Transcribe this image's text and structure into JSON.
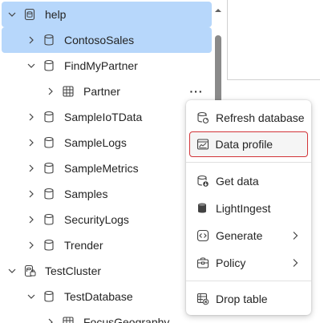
{
  "tree": {
    "rows": [
      {
        "label": "help",
        "kind": "cluster",
        "expanded": true,
        "selected": true
      },
      {
        "label": "ContosoSales",
        "kind": "database",
        "expanded": false,
        "selected": true
      },
      {
        "label": "FindMyPartner",
        "kind": "database",
        "expanded": true,
        "selected": false
      },
      {
        "label": "Partner",
        "kind": "table",
        "expanded": false,
        "selected": false
      },
      {
        "label": "SampleIoTData",
        "kind": "database",
        "expanded": false,
        "selected": false
      },
      {
        "label": "SampleLogs",
        "kind": "database",
        "expanded": false,
        "selected": false
      },
      {
        "label": "SampleMetrics",
        "kind": "database",
        "expanded": false,
        "selected": false
      },
      {
        "label": "Samples",
        "kind": "database",
        "expanded": false,
        "selected": false
      },
      {
        "label": "SecurityLogs",
        "kind": "database",
        "expanded": false,
        "selected": false
      },
      {
        "label": "Trender",
        "kind": "database",
        "expanded": false,
        "selected": false
      },
      {
        "label": "TestCluster",
        "kind": "cluster",
        "expanded": true,
        "selected": false
      },
      {
        "label": "TestDatabase",
        "kind": "database",
        "expanded": true,
        "selected": false
      },
      {
        "label": "FocusGeography",
        "kind": "table",
        "expanded": false,
        "selected": false
      }
    ],
    "more_label": "···"
  },
  "menu": {
    "items": [
      {
        "label": "Refresh database",
        "icon": "refresh-database-icon"
      },
      {
        "label": "Data profile",
        "icon": "data-profile-icon",
        "highlighted": true
      },
      {
        "label": "Get data",
        "icon": "get-data-icon"
      },
      {
        "label": "LightIngest",
        "icon": "light-ingest-icon"
      },
      {
        "label": "Generate",
        "icon": "generate-icon",
        "submenu": true
      },
      {
        "label": "Policy",
        "icon": "policy-icon",
        "submenu": true
      },
      {
        "label": "Drop table",
        "icon": "drop-table-icon"
      }
    ]
  },
  "colors": {
    "selected_bg": "#b7d7fb",
    "highlight_border": "#d13438",
    "text": "#242424",
    "scrollbar": "#8a8a8a"
  }
}
